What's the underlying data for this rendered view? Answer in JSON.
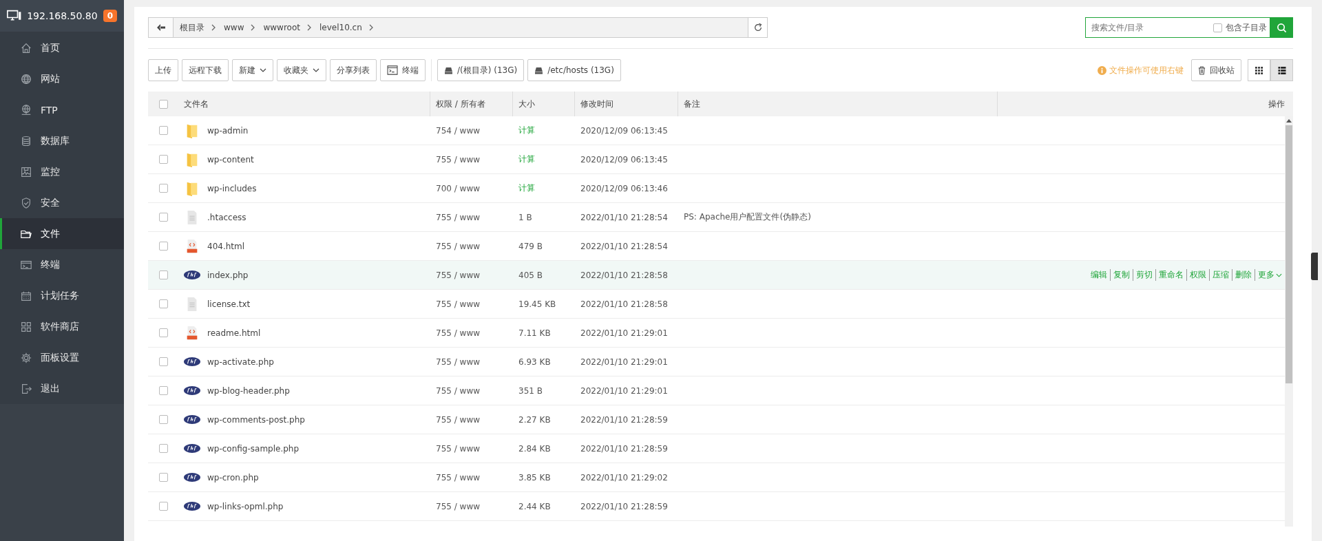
{
  "sidebar": {
    "host": "192.168.50.80",
    "badge": "0",
    "items": [
      {
        "label": "首页",
        "kind": "home",
        "selected": false
      },
      {
        "label": "网站",
        "kind": "globe",
        "selected": false
      },
      {
        "label": "FTP",
        "kind": "ftp",
        "selected": false
      },
      {
        "label": "数据库",
        "kind": "database",
        "selected": false
      },
      {
        "label": "监控",
        "kind": "monitor",
        "selected": false
      },
      {
        "label": "安全",
        "kind": "shield",
        "selected": false
      },
      {
        "label": "文件",
        "kind": "folder",
        "selected": true
      },
      {
        "label": "终端",
        "kind": "terminal",
        "selected": false
      },
      {
        "label": "计划任务",
        "kind": "calendar",
        "selected": false
      },
      {
        "label": "软件商店",
        "kind": "apps",
        "selected": false
      },
      {
        "label": "面板设置",
        "kind": "gear",
        "selected": false
      },
      {
        "label": "退出",
        "kind": "logout",
        "selected": false
      }
    ]
  },
  "breadcrumb": [
    "根目录",
    "www",
    "wwwroot",
    "level10.cn"
  ],
  "search": {
    "placeholder": "搜索文件/目录",
    "subdirs_label": "包含子目录",
    "subdirs_checked": false
  },
  "toolbar": [
    {
      "label": "上传",
      "kind": "plain"
    },
    {
      "label": "远程下载",
      "kind": "plain"
    },
    {
      "label": "新建",
      "kind": "dropdown"
    },
    {
      "label": "收藏夹",
      "kind": "dropdown"
    },
    {
      "label": "分享列表",
      "kind": "plain"
    },
    {
      "label": "终端",
      "kind": "terminal"
    }
  ],
  "disks": [
    "/(根目录) (13G)",
    "/etc/hosts (13G)"
  ],
  "hint": "文件操作可使用右键",
  "recycle": "回收站",
  "views": [
    {
      "kind": "grid",
      "selected": false
    },
    {
      "kind": "list",
      "selected": true
    }
  ],
  "table": {
    "all_checked": false,
    "columns": [
      "文件名",
      "权限 / 所有者",
      "大小",
      "修改时间",
      "备注",
      "操作"
    ],
    "rows": [
      {
        "kind": "folder",
        "name": "wp-admin",
        "perm": "754 / www",
        "size": "计算",
        "mtime": "2020/12/09 06:13:45",
        "checked": false,
        "highlighted": false
      },
      {
        "kind": "folder",
        "name": "wp-content",
        "perm": "755 / www",
        "size": "计算",
        "mtime": "2020/12/09 06:13:45",
        "checked": false,
        "highlighted": false
      },
      {
        "kind": "folder",
        "name": "wp-includes",
        "perm": "700 / www",
        "size": "计算",
        "mtime": "2020/12/09 06:13:46",
        "checked": false,
        "highlighted": false
      },
      {
        "kind": "text",
        "name": ".htaccess",
        "perm": "755 / www",
        "size": "1 B",
        "mtime": "2022/01/10 21:28:54",
        "note": "PS: Apache用户配置文件(伪静态)",
        "checked": false,
        "highlighted": false
      },
      {
        "kind": "html",
        "name": "404.html",
        "perm": "755 / www",
        "size": "479 B",
        "mtime": "2022/01/10 21:28:54",
        "checked": false,
        "highlighted": false
      },
      {
        "kind": "php",
        "name": "index.php",
        "perm": "755 / www",
        "size": "405 B",
        "mtime": "2022/01/10 21:28:58",
        "checked": false,
        "highlighted": true,
        "actions": [
          "编辑",
          "复制",
          "剪切",
          "重命名",
          "权限",
          "压缩",
          "删除",
          "更多"
        ]
      },
      {
        "kind": "text",
        "name": "license.txt",
        "perm": "755 / www",
        "size": "19.45 KB",
        "mtime": "2022/01/10 21:28:58",
        "checked": false,
        "highlighted": false
      },
      {
        "kind": "html",
        "name": "readme.html",
        "perm": "755 / www",
        "size": "7.11 KB",
        "mtime": "2022/01/10 21:29:01",
        "checked": false,
        "highlighted": false
      },
      {
        "kind": "php",
        "name": "wp-activate.php",
        "perm": "755 / www",
        "size": "6.93 KB",
        "mtime": "2022/01/10 21:29:01",
        "checked": false,
        "highlighted": false
      },
      {
        "kind": "php",
        "name": "wp-blog-header.php",
        "perm": "755 / www",
        "size": "351 B",
        "mtime": "2022/01/10 21:29:01",
        "checked": false,
        "highlighted": false
      },
      {
        "kind": "php",
        "name": "wp-comments-post.php",
        "perm": "755 / www",
        "size": "2.27 KB",
        "mtime": "2022/01/10 21:28:59",
        "checked": false,
        "highlighted": false
      },
      {
        "kind": "php",
        "name": "wp-config-sample.php",
        "perm": "755 / www",
        "size": "2.84 KB",
        "mtime": "2022/01/10 21:28:59",
        "checked": false,
        "highlighted": false
      },
      {
        "kind": "php",
        "name": "wp-cron.php",
        "perm": "755 / www",
        "size": "3.85 KB",
        "mtime": "2022/01/10 21:29:02",
        "checked": false,
        "highlighted": false
      },
      {
        "kind": "php",
        "name": "wp-links-opml.php",
        "perm": "755 / www",
        "size": "2.44 KB",
        "mtime": "2022/01/10 21:28:59",
        "checked": false,
        "highlighted": false
      }
    ]
  }
}
